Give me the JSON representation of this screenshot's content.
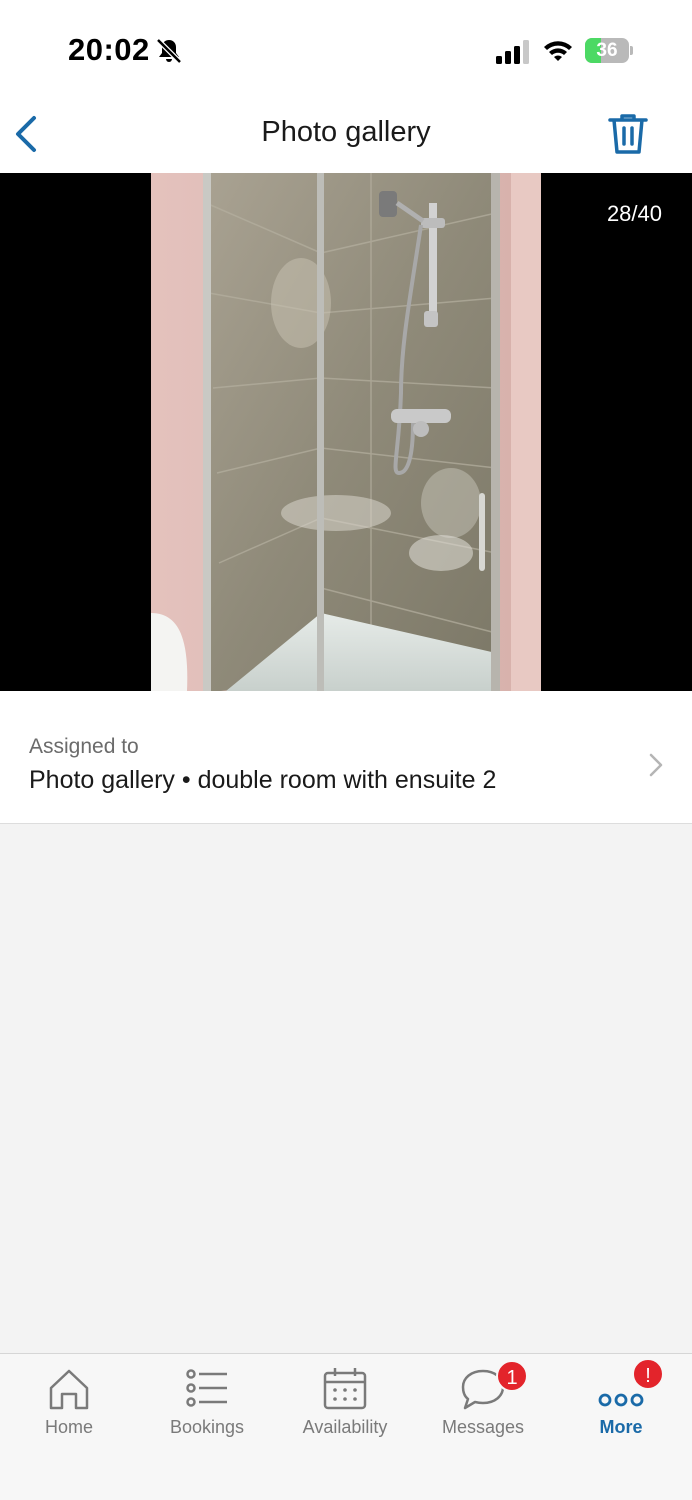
{
  "status_bar": {
    "time": "20:02",
    "battery_level": "36",
    "battery_fraction": 0.36
  },
  "nav": {
    "title": "Photo gallery",
    "back_icon": "chevron-left-icon",
    "delete_icon": "trash-icon"
  },
  "viewer": {
    "counter": "28/40"
  },
  "assigned": {
    "label": "Assigned to",
    "value": "Photo gallery • double room with ensuite 2"
  },
  "tabs": [
    {
      "label": "Home",
      "icon": "home-icon",
      "active": false
    },
    {
      "label": "Bookings",
      "icon": "list-icon",
      "active": false
    },
    {
      "label": "Availability",
      "icon": "calendar-icon",
      "active": false
    },
    {
      "label": "Messages",
      "icon": "chat-bubble-icon",
      "active": false,
      "badge": "1"
    },
    {
      "label": "More",
      "icon": "more-dots-icon",
      "active": true,
      "badge": "!"
    }
  ],
  "colors": {
    "accent": "#1a6aa8",
    "badge": "#e3242b",
    "battery": "#4cd964"
  }
}
